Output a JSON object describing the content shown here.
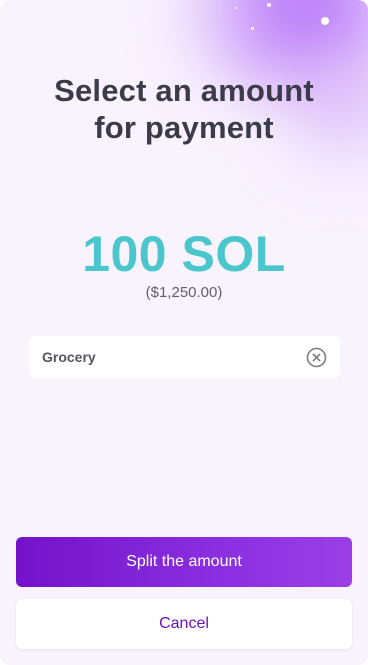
{
  "header": {
    "title": "Select an amount\nfor payment"
  },
  "amount": {
    "value": "100 SOL",
    "fiat": "($1,250.00)"
  },
  "note_field": {
    "value": "Grocery",
    "clear_icon": "close-circle-icon"
  },
  "actions": {
    "split_label": "Split the amount",
    "cancel_label": "Cancel"
  },
  "colors": {
    "background": "#f9f3fe",
    "title": "#3b3b4a",
    "amount": "#4bc6cc",
    "primary": "#7412c9",
    "secondary_text": "#6b12c4"
  }
}
